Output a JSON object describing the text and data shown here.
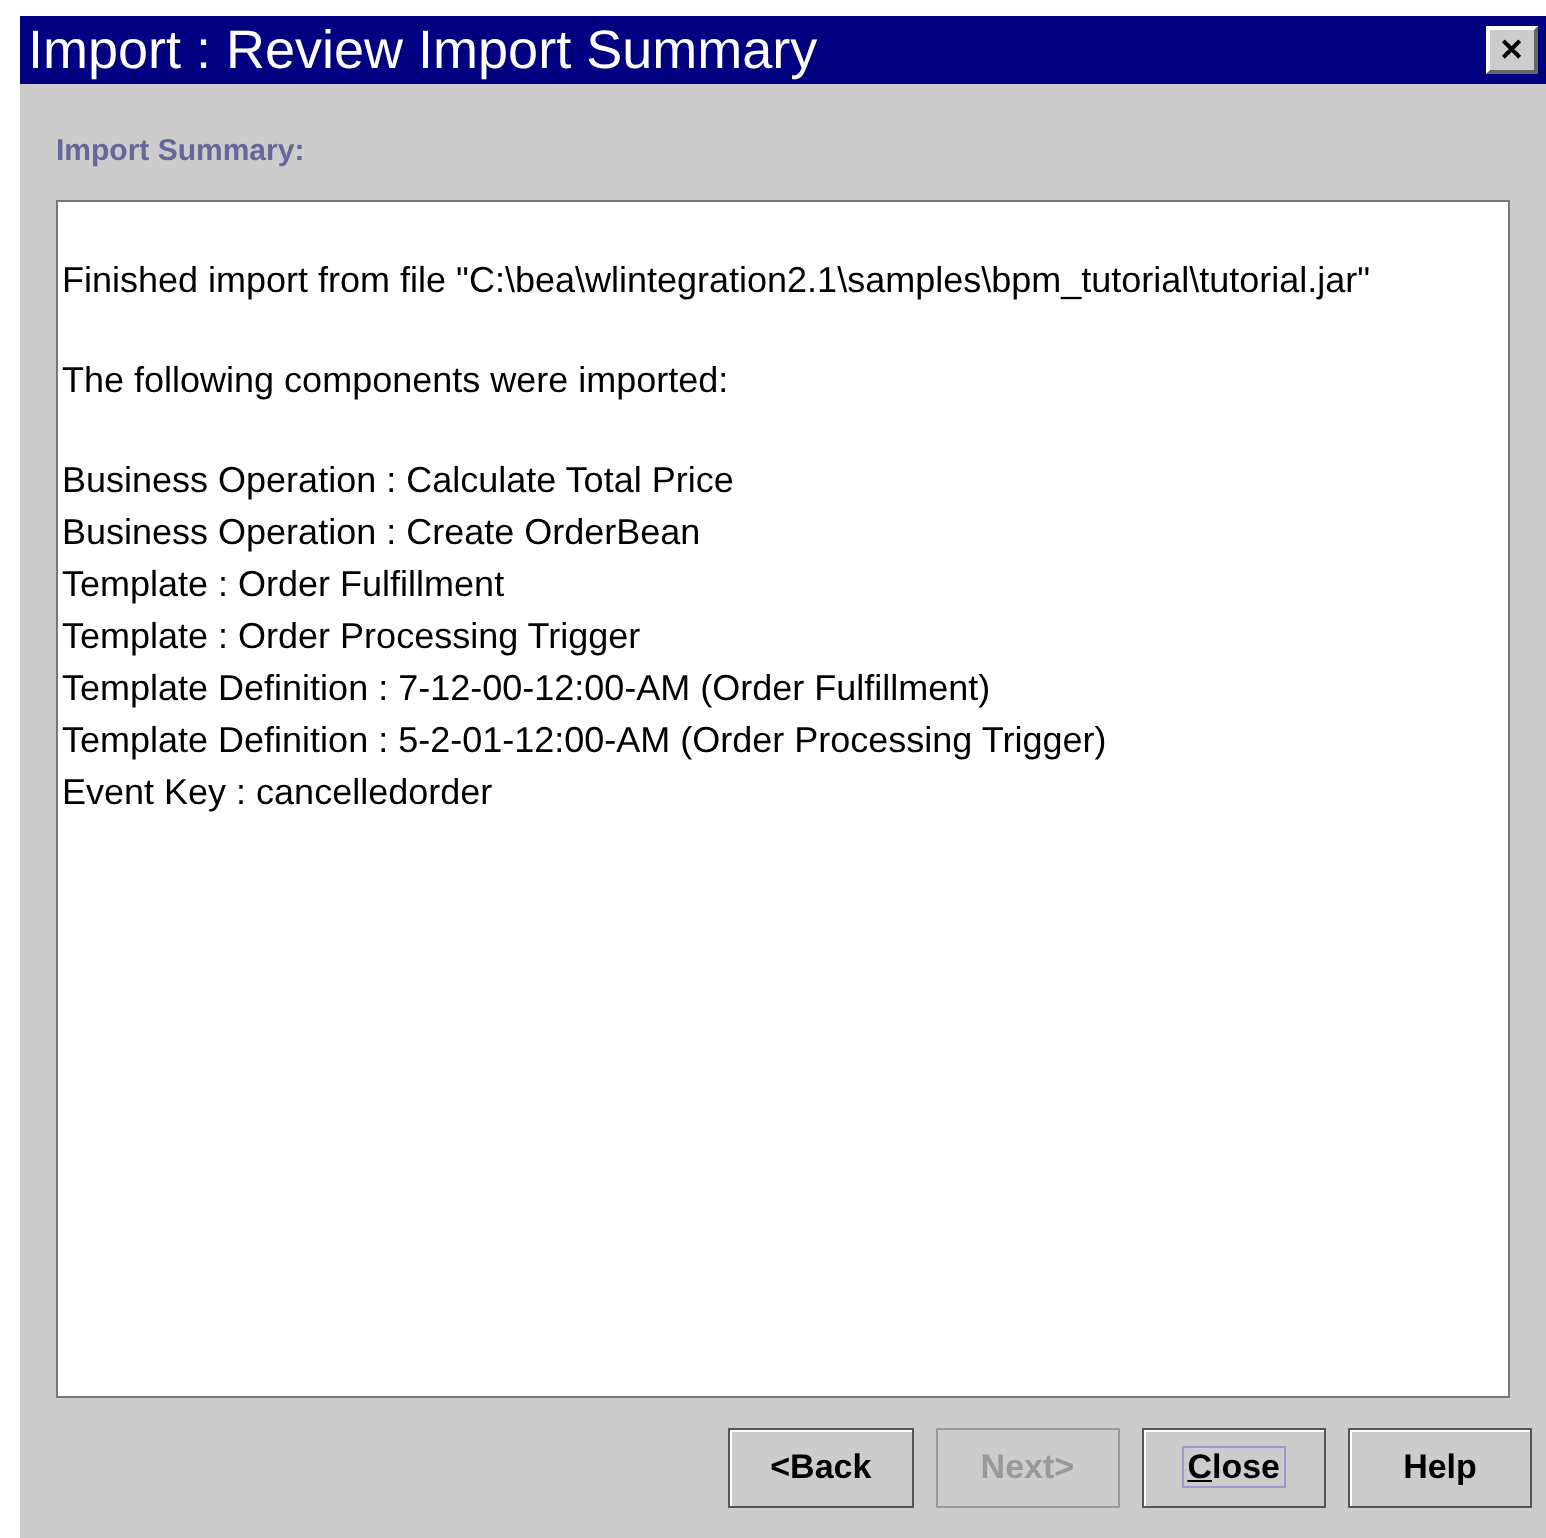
{
  "window": {
    "title": "Import : Review Import Summary",
    "close": "✕"
  },
  "section_label": "Import Summary:",
  "summary": {
    "lines": [
      "Finished import from file \"C:\\bea\\wlintegration2.1\\samples\\bpm_tutorial\\tutorial.jar\"",
      "The following components were imported:"
    ],
    "components": [
      "Business Operation : Calculate Total Price",
      "Business Operation : Create OrderBean",
      "Template : Order Fulfillment",
      "Template : Order Processing Trigger",
      "Template Definition : 7-12-00-12:00-AM (Order Fulfillment)",
      "Template Definition : 5-2-01-12:00-AM (Order Processing Trigger)",
      "Event Key : cancelledorder"
    ]
  },
  "buttons": [
    {
      "label": "<Back",
      "disabled": false,
      "focused": false,
      "underline_first": false
    },
    {
      "label": "Next>",
      "disabled": true,
      "focused": false,
      "underline_first": false
    },
    {
      "label": "Close",
      "disabled": false,
      "focused": true,
      "underline_first": true
    },
    {
      "label": "Help",
      "disabled": false,
      "focused": false,
      "underline_first": false
    }
  ]
}
